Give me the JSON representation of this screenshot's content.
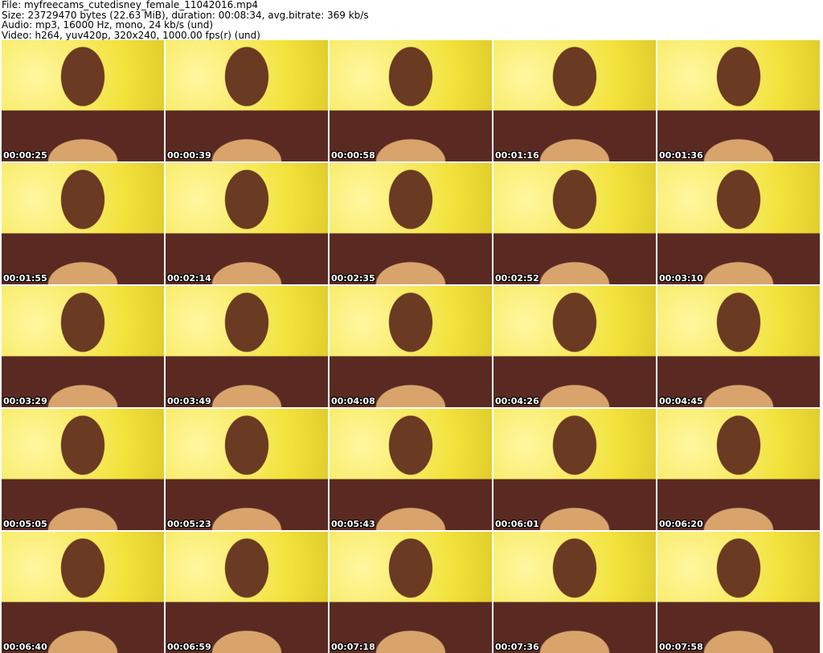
{
  "header": {
    "file": "File: myfreecams_cutedisney_female_11042016.mp4",
    "size": "Size: 23729470 bytes (22.63 MiB), duration: 00:08:34, avg.bitrate: 369 kb/s",
    "audio": "Audio: mp3, 16000 Hz, mono, 24 kb/s (und)",
    "video": "Video: h264, yuv420p, 320x240, 1000.00 fps(r) (und)"
  },
  "thumbnails": [
    "00:00:25",
    "00:00:39",
    "00:00:58",
    "00:01:16",
    "00:01:36",
    "00:01:55",
    "00:02:14",
    "00:02:35",
    "00:02:52",
    "00:03:10",
    "00:03:29",
    "00:03:49",
    "00:04:08",
    "00:04:26",
    "00:04:45",
    "00:05:05",
    "00:05:23",
    "00:05:43",
    "00:06:01",
    "00:06:20",
    "00:06:40",
    "00:06:59",
    "00:07:18",
    "00:07:36",
    "00:07:58"
  ]
}
